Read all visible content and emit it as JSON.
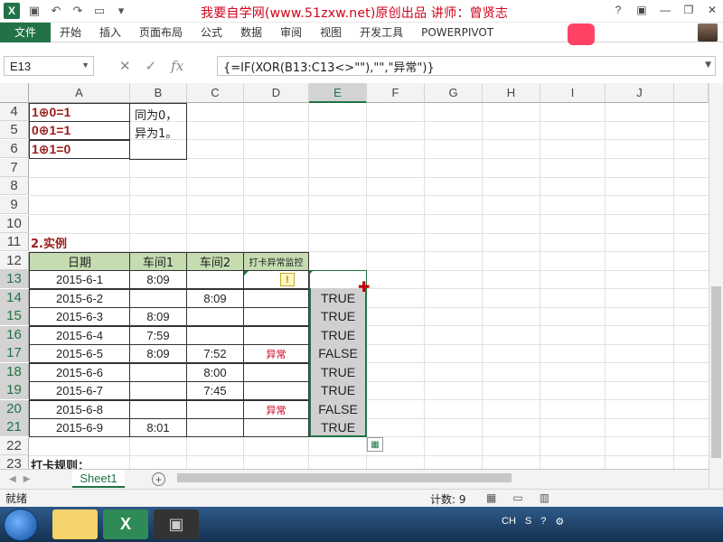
{
  "title_bar": {
    "title": "我要自学网(www.51zxw.net)原创出品  讲师：曾贤志",
    "app_icon": "excel-icon"
  },
  "ribbon": {
    "file": "文件",
    "tabs": [
      "开始",
      "插入",
      "页面布局",
      "公式",
      "数据",
      "审阅",
      "视图",
      "开发工具",
      "POWERPIVOT"
    ]
  },
  "formula_bar": {
    "name_box": "E13",
    "formula": "{=IF(XOR(B13:C13<>\"\"),\"\",\"异常\")}"
  },
  "columns": [
    "A",
    "B",
    "C",
    "D",
    "E",
    "F",
    "G",
    "H",
    "I",
    "J"
  ],
  "rows": [
    "4",
    "5",
    "6",
    "7",
    "8",
    "9",
    "10",
    "11",
    "12",
    "13",
    "14",
    "15",
    "16",
    "17",
    "18",
    "19",
    "20",
    "21",
    "22",
    "23"
  ],
  "xor_rules": [
    "1⊕0=1",
    "0⊕1=1",
    "1⊕1=0"
  ],
  "xor_note": [
    "同为0，",
    "异为1。"
  ],
  "section_title": "2.实例",
  "table": {
    "headers": [
      "日期",
      "车间1",
      "车间2",
      "打卡异常监控"
    ],
    "rows": [
      {
        "date": "2015-6-1",
        "c1": "8:09",
        "c2": "",
        "d": "",
        "e": ""
      },
      {
        "date": "2015-6-2",
        "c1": "",
        "c2": "8:09",
        "d": "",
        "e": "TRUE"
      },
      {
        "date": "2015-6-3",
        "c1": "8:09",
        "c2": "",
        "d": "",
        "e": "TRUE"
      },
      {
        "date": "2015-6-4",
        "c1": "7:59",
        "c2": "",
        "d": "",
        "e": "TRUE"
      },
      {
        "date": "2015-6-5",
        "c1": "8:09",
        "c2": "7:52",
        "d": "异常",
        "e": "FALSE"
      },
      {
        "date": "2015-6-6",
        "c1": "",
        "c2": "8:00",
        "d": "",
        "e": "TRUE"
      },
      {
        "date": "2015-6-7",
        "c1": "",
        "c2": "7:45",
        "d": "",
        "e": "TRUE"
      },
      {
        "date": "2015-6-8",
        "c1": "",
        "c2": "",
        "d": "异常",
        "e": "FALSE"
      },
      {
        "date": "2015-6-9",
        "c1": "8:01",
        "c2": "",
        "d": "",
        "e": "TRUE"
      }
    ]
  },
  "row23_text": "打卡规则：",
  "sheet_tab": "Sheet1",
  "status": {
    "ready": "就绪",
    "count": "计数: 9"
  },
  "tray": {
    "lang": "CH"
  }
}
